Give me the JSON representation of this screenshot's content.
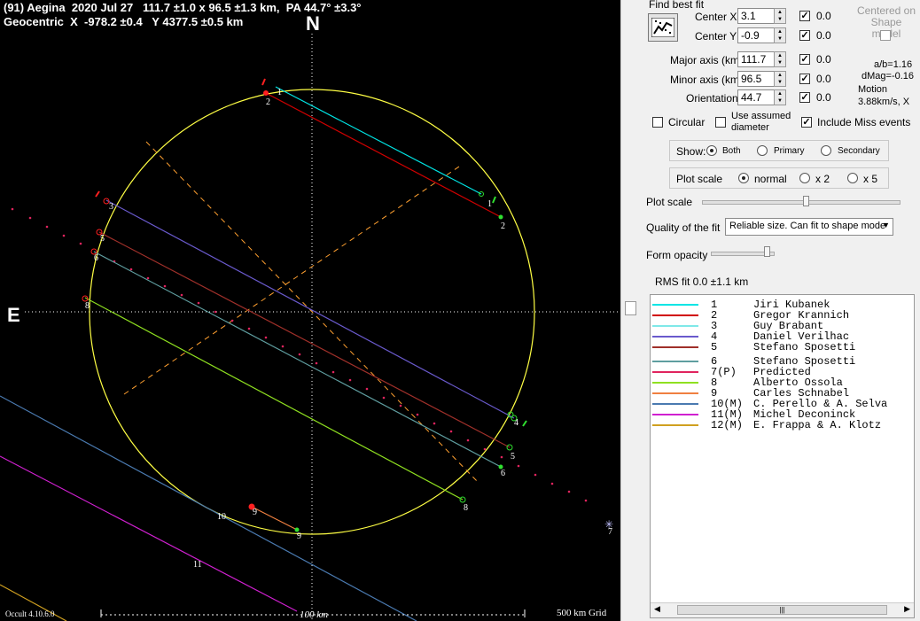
{
  "plot": {
    "header_line1": "(91) Aegina  2020 Jul 27   111.7 ±1.0 x 96.5 ±1.3 km,  PA 44.7° ±3.3°",
    "header_line2": "Geocentric  X  -978.2 ±0.4   Y 4377.5 ±0.5 km",
    "north": "N",
    "east": "E",
    "scale_label": "100 km",
    "grid_label": "500 km Grid",
    "version": "Occult 4.10.6.0",
    "chord_labels": [
      "1",
      "2",
      "3",
      "4",
      "5",
      "6",
      "7",
      "8",
      "9",
      "10",
      "11"
    ],
    "colors": {
      "ellipse": "#ffff44",
      "axes": "#ffa030"
    }
  },
  "panel": {
    "find_best_fit": "Find best fit",
    "centered_on_shape": "Centered on Shape model",
    "fit_rows": [
      {
        "label": "Center X",
        "value": "3.1",
        "result": "0.0",
        "checked": true
      },
      {
        "label": "Center Y",
        "value": "-0.9",
        "result": "0.0",
        "checked": true
      },
      {
        "label": "Major axis (km)",
        "value": "111.7",
        "result": "0.0",
        "checked": true
      },
      {
        "label": "Minor axis (km)",
        "value": "96.5",
        "result": "0.0",
        "checked": true
      },
      {
        "label": "Orientation",
        "value": "44.7",
        "result": "0.0",
        "checked": true
      }
    ],
    "ab_ratio": "a/b=1.16",
    "dmag": "dMag=-0.16",
    "motion_label": "Motion",
    "motion_value": "3.88km/s, X",
    "circular": "Circular",
    "use_assumed": "Use assumed diameter",
    "include_miss": "Include Miss events",
    "show_label": "Show:",
    "show_options": [
      "Both",
      "Primary",
      "Secondary"
    ],
    "plot_scale_label": "Plot scale",
    "plot_scale_options": [
      "normal",
      "x 2",
      "x 5"
    ],
    "plot_scale_slider_label": "Plot scale",
    "quality_label": "Quality of the fit",
    "quality_value": "Reliable size. Can fit to shape mode",
    "opacity_label": "Form opacity",
    "rms": "RMS fit 0.0 ±1.1 km"
  },
  "legend": [
    {
      "num": "1",
      "name": "Jiri Kubanek",
      "color": "#00e5e5"
    },
    {
      "num": "2",
      "name": "Gregor Krannich",
      "color": "#d00000"
    },
    {
      "num": "3",
      "name": "Guy Brabant",
      "color": "#7fe8e8"
    },
    {
      "num": "4",
      "name": "Daniel Verilhac",
      "color": "#6a5acd"
    },
    {
      "num": "5",
      "name": "Stefano Sposetti",
      "color": "#a0302a"
    },
    {
      "num": "6",
      "name": "Stefano Sposetti",
      "color": "#5f9ea0"
    },
    {
      "num": "7(P)",
      "name": "Predicted",
      "color": "#e0245e"
    },
    {
      "num": "8",
      "name": "Alberto Ossola",
      "color": "#8fe020"
    },
    {
      "num": "9",
      "name": "Carles Schnabel",
      "color": "#f08040"
    },
    {
      "num": "10(M)",
      "name": "C. Perello & A. Selva",
      "color": "#4a7ab0"
    },
    {
      "num": "11(M)",
      "name": "Michel Deconinck",
      "color": "#d020d0"
    },
    {
      "num": "12(M)",
      "name": "E. Frappa & A. Klotz",
      "color": "#d0a020"
    }
  ]
}
